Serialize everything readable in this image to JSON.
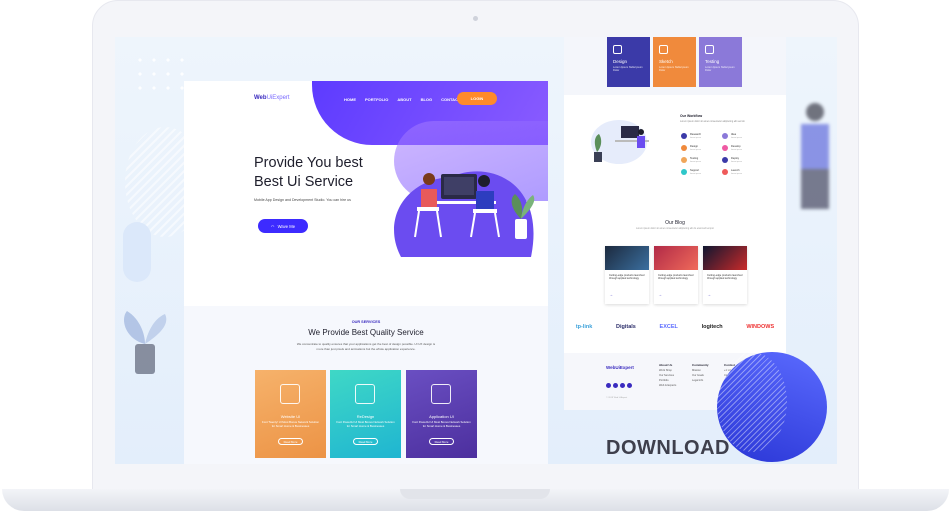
{
  "landing": {
    "logo_main": "Web",
    "logo_sub": "UiExpert",
    "nav": [
      "HOME",
      "PORTFOLIO",
      "ABOUT",
      "BLOG",
      "CONTACT"
    ],
    "login_label": "LOGIN",
    "hero_title_line1": "Provide You best",
    "hero_title_line2": "Best Ui Service",
    "hero_subtitle": "Mobile App Design and Development Studio. You can hire us",
    "hero_button": "Wave Me"
  },
  "services": {
    "tag": "OUR SERVICES",
    "title": "We Provide Best Quality Service",
    "description": "We concentrate to quality ensures that your applications get the best of design possible. UI UX design is more than just pixels and animations but the whole application experience.",
    "cards": [
      {
        "name": "Website UI",
        "desc": "Font Twenty! UI Most Bonus Network Solution for Smart Home & Businesses",
        "button": "Read More",
        "color": "#f0a65a"
      },
      {
        "name": "ReDesign",
        "desc": "Font Powerful UI Most Bonus Network Solution for Smart Home & Businesses",
        "button": "Read More",
        "color": "#2fc7c9"
      },
      {
        "name": "Application UI",
        "desc": "Font Powerful UI Most Bonus Network Solution for Smart Home & Businesses",
        "button": "Read More",
        "color": "#5b3fb0"
      }
    ]
  },
  "side": {
    "tiles": [
      {
        "name": "Design",
        "desc": "Lorem Ipsum Nulla Ipsum Dolor",
        "color": "#3b3aa8"
      },
      {
        "name": "Sketch",
        "desc": "Lorem Ipsum Nulla Ipsum Dolor",
        "color": "#f08a3c"
      },
      {
        "name": "Testing",
        "desc": "Lorem Ipsum Nulla Ipsum Dolor",
        "color": "#8b79d9"
      }
    ],
    "workflow_title": "Our Workflow",
    "workflow_desc": "Lorem ipsum dolor sit amet consectetur adipiscing elit sed do",
    "workflow_items": [
      {
        "label": "Research",
        "sub": "lorem ipsum",
        "color": "#3b3aa8"
      },
      {
        "label": "Idea",
        "sub": "lorem ipsum",
        "color": "#8b79d9"
      },
      {
        "label": "Design",
        "sub": "lorem ipsum",
        "color": "#f08a3c"
      },
      {
        "label": "Develop",
        "sub": "lorem ipsum",
        "color": "#ef5aa3"
      },
      {
        "label": "Testing",
        "sub": "lorem ipsum",
        "color": "#f0a65a"
      },
      {
        "label": "Deploy",
        "sub": "lorem ipsum",
        "color": "#3b3aa8"
      },
      {
        "label": "Support",
        "sub": "lorem ipsum",
        "color": "#2fc7c9"
      },
      {
        "label": "Launch",
        "sub": "lorem ipsum",
        "color": "#ef5a5a"
      }
    ],
    "blog_title": "Our Blog",
    "blog_desc": "Lorem ipsum dolor sit amet consectetur adipiscing elit do eiusmod tempor",
    "blog_posts": [
      {
        "title": "Cutting-edge products launched through applied technology",
        "arrow": "→",
        "img": "#1c2a3e"
      },
      {
        "title": "Cutting-edge products launched through applied technology",
        "arrow": "→",
        "img": "#b12a47"
      },
      {
        "title": "Cutting-edge products launched through applied technology",
        "arrow": "→",
        "img": "#0f1630"
      }
    ],
    "brands": [
      {
        "name": "tp-link",
        "color": "#3aa0d9"
      },
      {
        "name": "Digitals",
        "color": "#2d2f6b"
      },
      {
        "name": "EXCEL",
        "color": "#5b6bff"
      },
      {
        "name": "logitech",
        "color": "#222"
      },
      {
        "name": "WINDOWS",
        "color": "#e33"
      }
    ],
    "footer_logo": "WebUiExpert",
    "footer_cols": [
      {
        "head": "About Us",
        "items": [
          "Work Shop",
          "Our Services",
          "Portfolio",
          "Web & Experts"
        ]
      },
      {
        "head": "Community",
        "items": [
          "Mission",
          "Our Goals",
          "Legal info"
        ]
      },
      {
        "head": "Contact",
        "items": [
          "+1 23 456 789",
          "Contact Us"
        ]
      }
    ],
    "footer_copy": "© 2019 Web UiExpert"
  },
  "download_text": "DOWNLOAD"
}
